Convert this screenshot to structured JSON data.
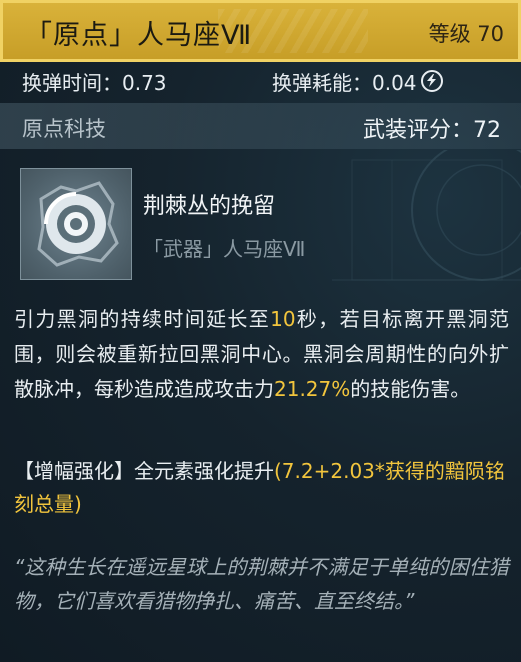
{
  "header": {
    "title": "「原点」人马座Ⅶ",
    "level": "等级 70"
  },
  "stats": {
    "reload_time_label": "换弹时间：",
    "reload_time_value": "0.73",
    "reload_energy_label": "换弹耗能：",
    "reload_energy_value": "0.04"
  },
  "section": {
    "name": "原点科技",
    "score_label": "武装评分：",
    "score_value": "72"
  },
  "skill": {
    "icon": "swirl-vortex-icon",
    "title": "荆棘丛的挽留",
    "subtitle": "「武器」人马座Ⅶ"
  },
  "description": {
    "p1": "引力黑洞的持续时间延长至",
    "p1_hl": "10",
    "p2": "秒，若目标离开黑洞范围，则会被重新拉回黑洞中心。黑洞会周期性的向外扩散脉冲，每秒造成造成攻击力",
    "p2_hl": "21.27%",
    "p3": "的技能伤害。"
  },
  "amplify": {
    "label": "【增幅强化】全元素强化提升",
    "formula": "(7.2+2.03*获得的黯陨铭刻总量)"
  },
  "quote": "“这种生长在遥远星球上的荆棘并不满足于单纯的困住猎物，它们喜欢看猎物挣扎、痛苦、直至终结。”",
  "colors": {
    "header_gold": "#d9b23a",
    "highlight": "#f2c53d"
  }
}
